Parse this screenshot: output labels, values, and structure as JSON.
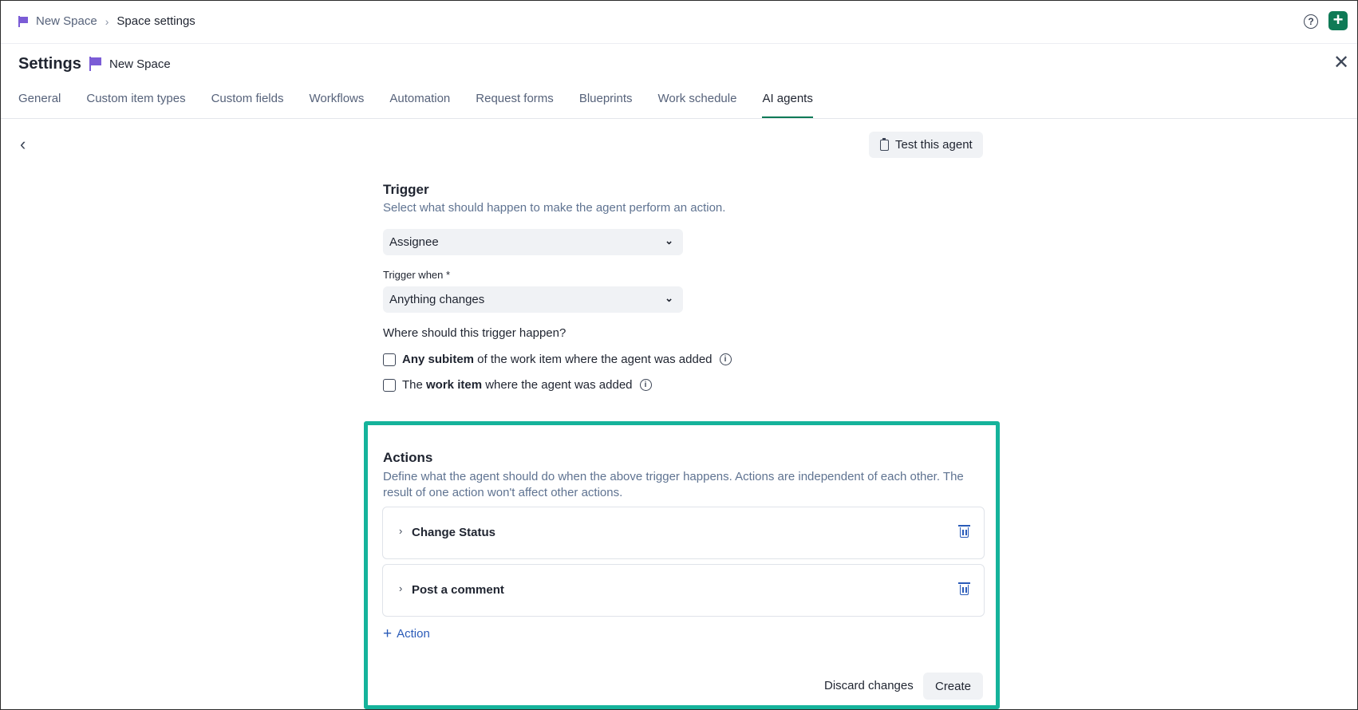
{
  "breadcrumb": {
    "space": "New Space",
    "sep": "›",
    "current": "Space settings"
  },
  "topbar": {
    "help_icon": "?",
    "add_icon": "+"
  },
  "header": {
    "title": "Settings",
    "space_name": "New Space",
    "close_icon": "✕"
  },
  "tabs": [
    {
      "label": "General"
    },
    {
      "label": "Custom item types"
    },
    {
      "label": "Custom fields"
    },
    {
      "label": "Workflows"
    },
    {
      "label": "Automation"
    },
    {
      "label": "Request forms"
    },
    {
      "label": "Blueprints"
    },
    {
      "label": "Work schedule"
    },
    {
      "label": "AI agents",
      "active": true
    }
  ],
  "toolbar": {
    "back_icon": "‹",
    "test_label": "Test this agent"
  },
  "trigger": {
    "title": "Trigger",
    "description": "Select what should happen to make the agent perform an action.",
    "field_value": "Assignee",
    "when_label": "Trigger when *",
    "when_value": "Anything changes",
    "where_label": "Where should this trigger happen?",
    "options": [
      {
        "bold": "Any subitem",
        "pre": "",
        "post": " of the work item where the agent was added",
        "checked": false
      },
      {
        "pre": "The ",
        "bold": "work item",
        "post": " where the agent was added",
        "checked": false
      }
    ]
  },
  "actions": {
    "title": "Actions",
    "description": "Define what the agent should do when the above trigger happens. Actions are independent of each other. The result of one action won't affect other actions.",
    "items": [
      {
        "label": "Change Status"
      },
      {
        "label": "Post a comment"
      }
    ],
    "add_label": "Action",
    "discard_label": "Discard changes",
    "create_label": "Create"
  },
  "colors": {
    "accent": "#0f7a56",
    "highlight": "#15b39b",
    "link": "#2a5bb8",
    "flag": "#7b5cd6"
  }
}
